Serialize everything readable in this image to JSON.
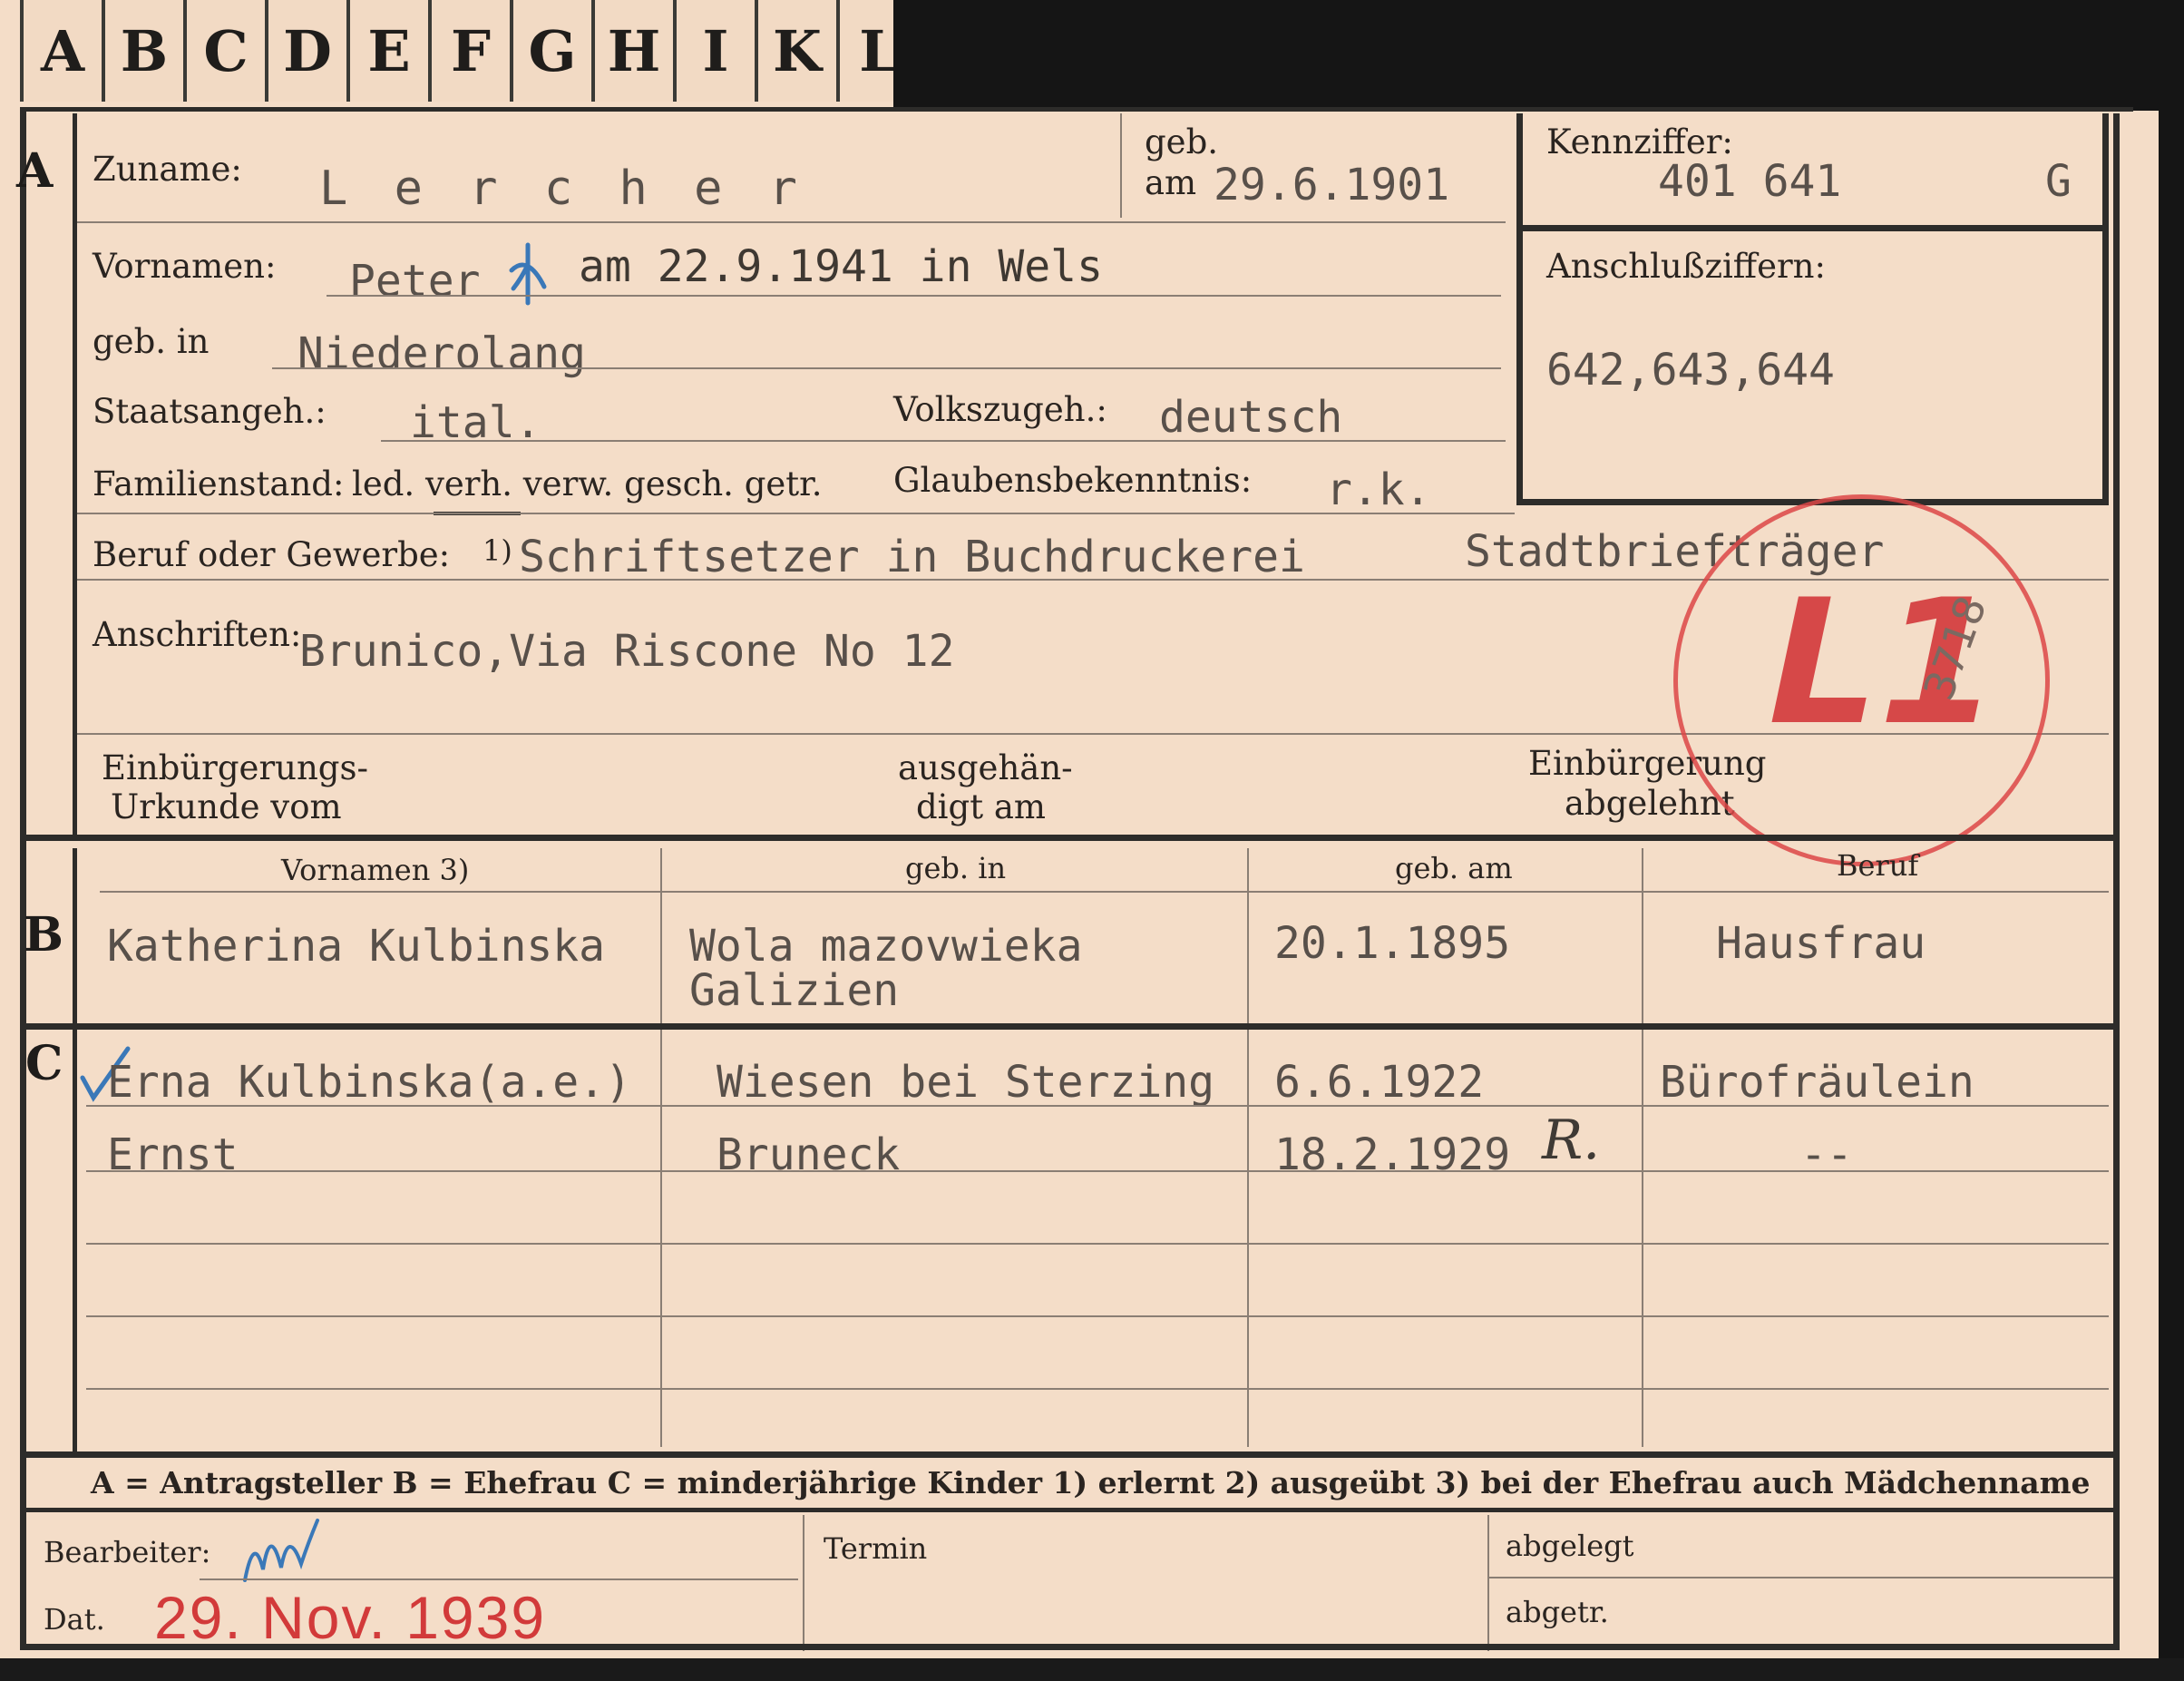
{
  "tabs": [
    "A",
    "B",
    "C",
    "D",
    "E",
    "F",
    "G",
    "H",
    "I",
    "K",
    "L"
  ],
  "sections": {
    "a": "A",
    "b": "B",
    "c": "C"
  },
  "applicant": {
    "zuname_label": "Zuname:",
    "zuname_value": "L e r c h e r",
    "geb_label": "geb.",
    "geb_am_label": "am",
    "geb_am_value": "29.6.1901",
    "kennziffer_label": "Kennziffer:",
    "kennziffer_value": "401 641",
    "kennziffer_suffix": "G",
    "vornamen_label": "Vornamen:",
    "vornamen_value": "Peter",
    "vornamen_death_note": "am 22.9.1941 in Wels",
    "anschluss_label": "Anschlußziffern:",
    "anschluss_value": "642,643,644",
    "geb_in_label": "geb. in",
    "geb_in_value": "Niederolang",
    "staat_label": "Staatsangeh.:",
    "staat_value": "ital.",
    "volk_label": "Volkszugeh.:",
    "volk_value": "deutsch",
    "familienstand_label": "Familienstand:",
    "familienstand_options": "led. verh. verw. gesch. getr.",
    "glauben_label": "Glaubensbekenntnis:",
    "glauben_value": "r.k.",
    "beruf_label": "Beruf oder Gewerbe:",
    "beruf_fn": "1)",
    "beruf_value_1": "Schriftsetzer in Buchdruckerei",
    "beruf_value_2": "Stadtbriefträger",
    "anschrift_label": "Anschriften:",
    "anschrift_value": "Brunico,Via Riscone No 12",
    "einb_label_1": "Einbürgerungs-",
    "einb_label_2": "Urkunde vom",
    "ausgeh_label_1": "ausgehän-",
    "ausgeh_label_2": "digt am",
    "abgelehnt_label_1": "Einbürgerung",
    "abgelehnt_label_2": "abgelehnt"
  },
  "stamp": {
    "text": "L1",
    "number": "3718",
    "color": "#d23a3a"
  },
  "spouse_headers": [
    "Vornamen 3)",
    "geb. in",
    "geb. am",
    "Beruf"
  ],
  "spouse": {
    "name": "Katherina Kulbinska",
    "geb_in_1": "Wola mazovwieka",
    "geb_in_2": "Galizien",
    "geb_am": "20.1.1895",
    "beruf": "Hausfrau"
  },
  "children": [
    {
      "name": "Erna Kulbinska(a.e.)",
      "geb_in": "Wiesen bei Sterzing",
      "geb_am": "6.6.1922",
      "beruf": "Bürofräulein"
    },
    {
      "name": "Ernst",
      "geb_in": "Bruneck",
      "geb_am": "18.2.1929",
      "beruf": "--",
      "mark": "R."
    }
  ],
  "legend": "A = Antragsteller   B = Ehefrau   C = minderjährige Kinder   1) erlernt   2) ausgeübt   3) bei der Ehefrau auch Mädchenname",
  "footer": {
    "bearbeiter_label": "Bearbeiter:",
    "dat_label": "Dat.",
    "date_stamp": "29. Nov. 1939",
    "termin_label": "Termin",
    "abgelegt_label": "abgelegt",
    "abgetr_label": "abgetr."
  }
}
